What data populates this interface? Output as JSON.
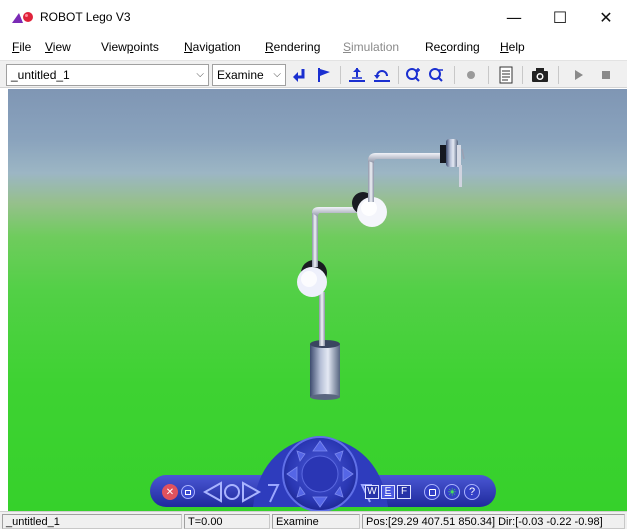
{
  "window": {
    "title": "ROBOT Lego V3",
    "minimize_glyph": "—",
    "maximize_glyph": "☐",
    "close_glyph": "✕"
  },
  "menu": {
    "items": [
      {
        "label": "File",
        "underline": "F",
        "rest": "ile"
      },
      {
        "label": "View",
        "underline": "V",
        "rest": "iew"
      },
      {
        "label": "Viewpoints",
        "pre": "View",
        "underline": "p",
        "rest": "oints"
      },
      {
        "label": "Navigation",
        "underline": "N",
        "rest": "avigation"
      },
      {
        "label": "Rendering",
        "underline": "R",
        "rest": "endering"
      },
      {
        "label": "Simulation",
        "underline": "S",
        "rest": "imulation",
        "disabled": true
      },
      {
        "label": "Recording",
        "pre": "Re",
        "underline": "c",
        "rest": "ording"
      },
      {
        "label": "Help",
        "underline": "H",
        "rest": "elp"
      }
    ]
  },
  "toolbar": {
    "viewpoint_value": "_untitled_1",
    "mode_value": "Examine",
    "icons": [
      "return-arrow-icon",
      "flag-icon",
      "align-icon",
      "undo-view-icon",
      "zoom-in-icon",
      "zoom-out-icon",
      "record-dot-icon",
      "document-icon",
      "camera-icon",
      "play-icon",
      "stop-icon"
    ]
  },
  "nav_panel": {
    "walk_label": "W",
    "examine_label": "E",
    "fly_label": "F",
    "help_label": "?"
  },
  "status": {
    "viewpoint": "_untitled_1",
    "time": "T=0.00",
    "mode": "Examine",
    "position": "Pos:[29.29 407.51 850.34] Dir:[-0.03 -0.22 -0.98]"
  },
  "colors": {
    "accent_blue": "#2a3fbf",
    "sky": "#8aa3bd",
    "ground": "#3ed232"
  }
}
